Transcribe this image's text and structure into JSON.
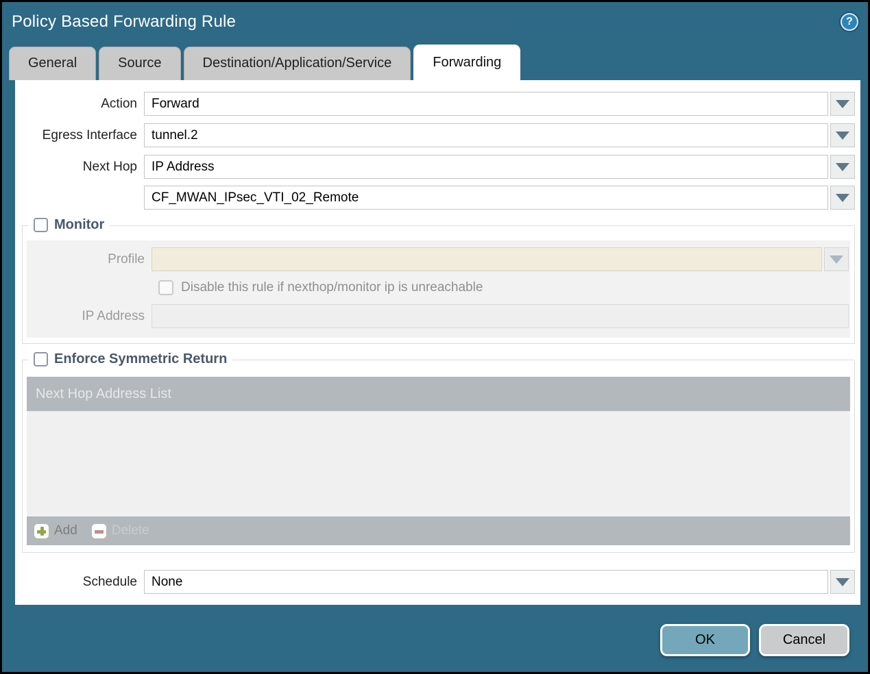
{
  "dialog": {
    "title": "Policy Based Forwarding Rule",
    "help_icon_glyph": "?"
  },
  "tabs": [
    {
      "label": "General",
      "active": false
    },
    {
      "label": "Source",
      "active": false
    },
    {
      "label": "Destination/Application/Service",
      "active": false
    },
    {
      "label": "Forwarding",
      "active": true
    }
  ],
  "form": {
    "action": {
      "label": "Action",
      "value": "Forward"
    },
    "egress_interface": {
      "label": "Egress Interface",
      "value": "tunnel.2"
    },
    "next_hop": {
      "label": "Next Hop",
      "value": "IP Address"
    },
    "next_hop_address": {
      "value": "CF_MWAN_IPsec_VTI_02_Remote"
    },
    "schedule": {
      "label": "Schedule",
      "value": "None"
    }
  },
  "monitor_section": {
    "legend": "Monitor",
    "checked": false,
    "profile": {
      "label": "Profile",
      "value": ""
    },
    "disable_rule": {
      "label": "Disable this rule if nexthop/monitor ip is unreachable",
      "checked": false
    },
    "ip_address": {
      "label": "IP Address",
      "value": ""
    }
  },
  "symmetric_return_section": {
    "legend": "Enforce Symmetric Return",
    "checked": false,
    "table_header": "Next Hop Address List",
    "rows": [],
    "add_label": "Add",
    "delete_label": "Delete"
  },
  "footer": {
    "ok_label": "OK",
    "cancel_label": "Cancel"
  },
  "colors": {
    "chrome_teal": "#2e6986",
    "ok_button": "#74a7ba",
    "cancel_button": "#c9cbcc",
    "table_gray": "#b3b8bc",
    "disabled_field_cream": "#f1ecdb",
    "legend_text": "#48596b"
  }
}
